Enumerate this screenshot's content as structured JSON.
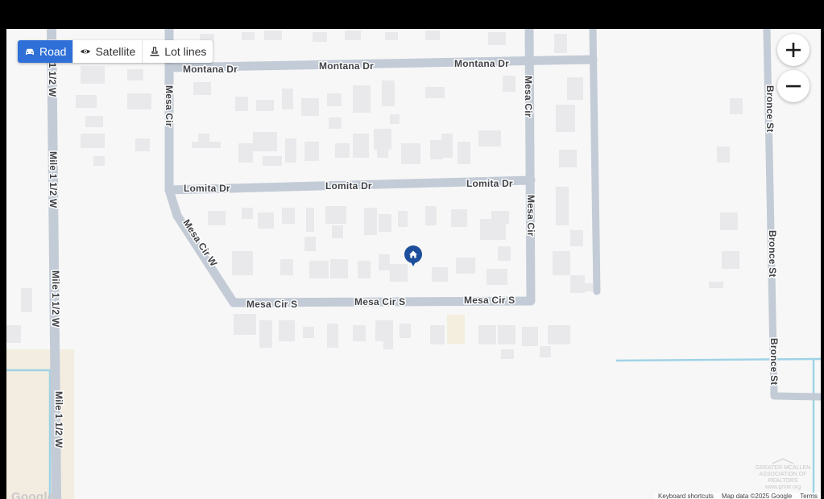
{
  "map_types": [
    {
      "label": "Road",
      "icon": "car-icon",
      "active": true
    },
    {
      "label": "Satellite",
      "icon": "eye-icon",
      "active": false
    },
    {
      "label": "Lot lines",
      "icon": "survey-marker-icon",
      "active": false
    }
  ],
  "zoom": {
    "in_symbol": "+",
    "out_symbol": "−"
  },
  "streets": {
    "montana_dr": "Montana Dr",
    "mesa_cir": "Mesa Cir",
    "lomita_dr": "Lomita Dr",
    "mesa_cir_w": "Mesa Cir W",
    "mesa_cir_s": "Mesa Cir S",
    "mile": "Mile 1 1/2 W",
    "bronce_st": "Bronce St"
  },
  "marker": {
    "icon": "home-icon",
    "color": "#1d4e9b"
  },
  "footer": {
    "google_logo": "Google",
    "keyboard_shortcuts": "Keyboard shortcuts",
    "map_data": "Map data ©2025 Google",
    "terms": "Terms"
  },
  "watermark": {
    "line1": "GREATER MCALLEN",
    "line2": "ASSOCIATION OF REALTORS",
    "line3": "www.gmar.org"
  },
  "colors": {
    "road": "#c3cbd6",
    "water": "#9fd3e6",
    "active_tab": "#2f70d8"
  }
}
